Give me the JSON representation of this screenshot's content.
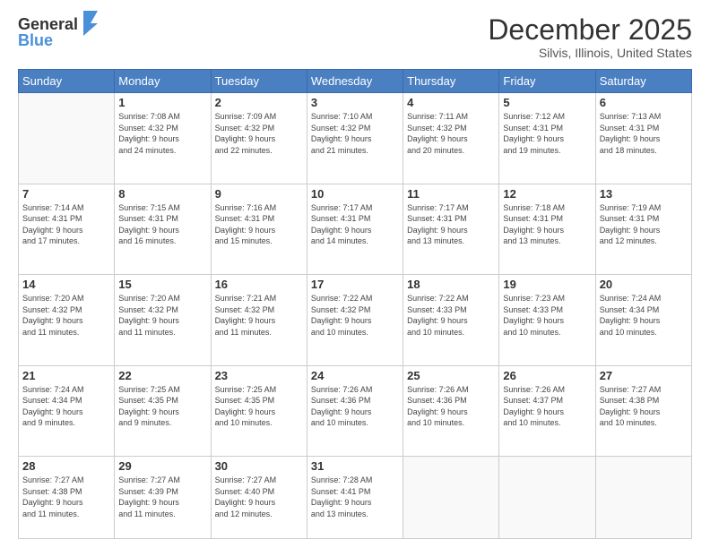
{
  "logo": {
    "general": "General",
    "blue": "Blue"
  },
  "header": {
    "month": "December 2025",
    "location": "Silvis, Illinois, United States"
  },
  "days_of_week": [
    "Sunday",
    "Monday",
    "Tuesday",
    "Wednesday",
    "Thursday",
    "Friday",
    "Saturday"
  ],
  "weeks": [
    [
      {
        "num": "",
        "sunrise": "",
        "sunset": "",
        "daylight": ""
      },
      {
        "num": "1",
        "sunrise": "Sunrise: 7:08 AM",
        "sunset": "Sunset: 4:32 PM",
        "daylight": "Daylight: 9 hours and 24 minutes."
      },
      {
        "num": "2",
        "sunrise": "Sunrise: 7:09 AM",
        "sunset": "Sunset: 4:32 PM",
        "daylight": "Daylight: 9 hours and 22 minutes."
      },
      {
        "num": "3",
        "sunrise": "Sunrise: 7:10 AM",
        "sunset": "Sunset: 4:32 PM",
        "daylight": "Daylight: 9 hours and 21 minutes."
      },
      {
        "num": "4",
        "sunrise": "Sunrise: 7:11 AM",
        "sunset": "Sunset: 4:32 PM",
        "daylight": "Daylight: 9 hours and 20 minutes."
      },
      {
        "num": "5",
        "sunrise": "Sunrise: 7:12 AM",
        "sunset": "Sunset: 4:31 PM",
        "daylight": "Daylight: 9 hours and 19 minutes."
      },
      {
        "num": "6",
        "sunrise": "Sunrise: 7:13 AM",
        "sunset": "Sunset: 4:31 PM",
        "daylight": "Daylight: 9 hours and 18 minutes."
      }
    ],
    [
      {
        "num": "7",
        "sunrise": "Sunrise: 7:14 AM",
        "sunset": "Sunset: 4:31 PM",
        "daylight": "Daylight: 9 hours and 17 minutes."
      },
      {
        "num": "8",
        "sunrise": "Sunrise: 7:15 AM",
        "sunset": "Sunset: 4:31 PM",
        "daylight": "Daylight: 9 hours and 16 minutes."
      },
      {
        "num": "9",
        "sunrise": "Sunrise: 7:16 AM",
        "sunset": "Sunset: 4:31 PM",
        "daylight": "Daylight: 9 hours and 15 minutes."
      },
      {
        "num": "10",
        "sunrise": "Sunrise: 7:17 AM",
        "sunset": "Sunset: 4:31 PM",
        "daylight": "Daylight: 9 hours and 14 minutes."
      },
      {
        "num": "11",
        "sunrise": "Sunrise: 7:17 AM",
        "sunset": "Sunset: 4:31 PM",
        "daylight": "Daylight: 9 hours and 13 minutes."
      },
      {
        "num": "12",
        "sunrise": "Sunrise: 7:18 AM",
        "sunset": "Sunset: 4:31 PM",
        "daylight": "Daylight: 9 hours and 13 minutes."
      },
      {
        "num": "13",
        "sunrise": "Sunrise: 7:19 AM",
        "sunset": "Sunset: 4:31 PM",
        "daylight": "Daylight: 9 hours and 12 minutes."
      }
    ],
    [
      {
        "num": "14",
        "sunrise": "Sunrise: 7:20 AM",
        "sunset": "Sunset: 4:32 PM",
        "daylight": "Daylight: 9 hours and 11 minutes."
      },
      {
        "num": "15",
        "sunrise": "Sunrise: 7:20 AM",
        "sunset": "Sunset: 4:32 PM",
        "daylight": "Daylight: 9 hours and 11 minutes."
      },
      {
        "num": "16",
        "sunrise": "Sunrise: 7:21 AM",
        "sunset": "Sunset: 4:32 PM",
        "daylight": "Daylight: 9 hours and 11 minutes."
      },
      {
        "num": "17",
        "sunrise": "Sunrise: 7:22 AM",
        "sunset": "Sunset: 4:32 PM",
        "daylight": "Daylight: 9 hours and 10 minutes."
      },
      {
        "num": "18",
        "sunrise": "Sunrise: 7:22 AM",
        "sunset": "Sunset: 4:33 PM",
        "daylight": "Daylight: 9 hours and 10 minutes."
      },
      {
        "num": "19",
        "sunrise": "Sunrise: 7:23 AM",
        "sunset": "Sunset: 4:33 PM",
        "daylight": "Daylight: 9 hours and 10 minutes."
      },
      {
        "num": "20",
        "sunrise": "Sunrise: 7:24 AM",
        "sunset": "Sunset: 4:34 PM",
        "daylight": "Daylight: 9 hours and 10 minutes."
      }
    ],
    [
      {
        "num": "21",
        "sunrise": "Sunrise: 7:24 AM",
        "sunset": "Sunset: 4:34 PM",
        "daylight": "Daylight: 9 hours and 9 minutes."
      },
      {
        "num": "22",
        "sunrise": "Sunrise: 7:25 AM",
        "sunset": "Sunset: 4:35 PM",
        "daylight": "Daylight: 9 hours and 9 minutes."
      },
      {
        "num": "23",
        "sunrise": "Sunrise: 7:25 AM",
        "sunset": "Sunset: 4:35 PM",
        "daylight": "Daylight: 9 hours and 10 minutes."
      },
      {
        "num": "24",
        "sunrise": "Sunrise: 7:26 AM",
        "sunset": "Sunset: 4:36 PM",
        "daylight": "Daylight: 9 hours and 10 minutes."
      },
      {
        "num": "25",
        "sunrise": "Sunrise: 7:26 AM",
        "sunset": "Sunset: 4:36 PM",
        "daylight": "Daylight: 9 hours and 10 minutes."
      },
      {
        "num": "26",
        "sunrise": "Sunrise: 7:26 AM",
        "sunset": "Sunset: 4:37 PM",
        "daylight": "Daylight: 9 hours and 10 minutes."
      },
      {
        "num": "27",
        "sunrise": "Sunrise: 7:27 AM",
        "sunset": "Sunset: 4:38 PM",
        "daylight": "Daylight: 9 hours and 10 minutes."
      }
    ],
    [
      {
        "num": "28",
        "sunrise": "Sunrise: 7:27 AM",
        "sunset": "Sunset: 4:38 PM",
        "daylight": "Daylight: 9 hours and 11 minutes."
      },
      {
        "num": "29",
        "sunrise": "Sunrise: 7:27 AM",
        "sunset": "Sunset: 4:39 PM",
        "daylight": "Daylight: 9 hours and 11 minutes."
      },
      {
        "num": "30",
        "sunrise": "Sunrise: 7:27 AM",
        "sunset": "Sunset: 4:40 PM",
        "daylight": "Daylight: 9 hours and 12 minutes."
      },
      {
        "num": "31",
        "sunrise": "Sunrise: 7:28 AM",
        "sunset": "Sunset: 4:41 PM",
        "daylight": "Daylight: 9 hours and 13 minutes."
      },
      {
        "num": "",
        "sunrise": "",
        "sunset": "",
        "daylight": ""
      },
      {
        "num": "",
        "sunrise": "",
        "sunset": "",
        "daylight": ""
      },
      {
        "num": "",
        "sunrise": "",
        "sunset": "",
        "daylight": ""
      }
    ]
  ]
}
